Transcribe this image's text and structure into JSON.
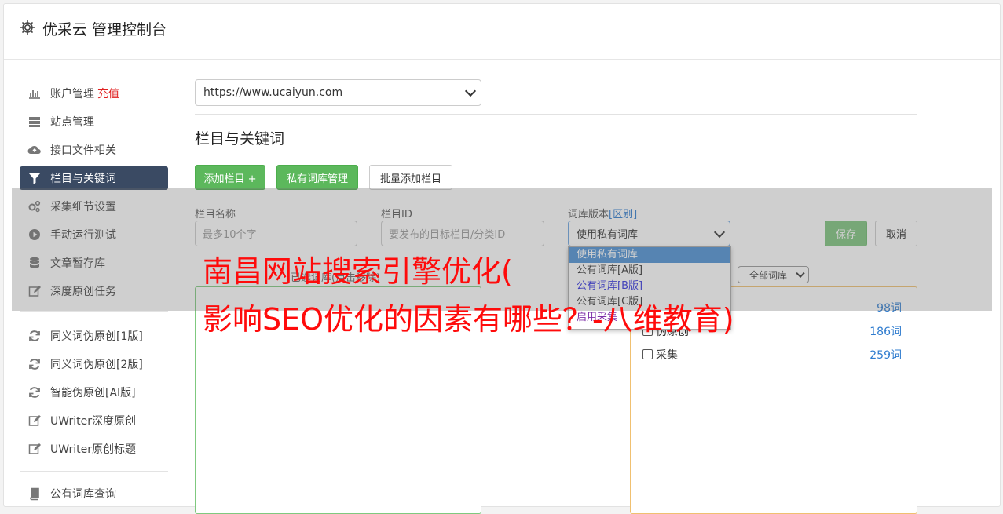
{
  "header": {
    "title": "优采云 管理控制台"
  },
  "sidebar": {
    "items": [
      {
        "label": "账户管理",
        "badge": "充值"
      },
      {
        "label": "站点管理"
      },
      {
        "label": "接口文件相关"
      },
      {
        "label": "栏目与关键词"
      },
      {
        "label": "采集细节设置"
      },
      {
        "label": "手动运行测试"
      },
      {
        "label": "文章暂存库"
      },
      {
        "label": "深度原创任务"
      },
      {
        "label": "同义词伪原创[1版]"
      },
      {
        "label": "同义词伪原创[2版]"
      },
      {
        "label": "智能伪原创[AI版]"
      },
      {
        "label": "UWriter深度原创"
      },
      {
        "label": "UWriter原创标题"
      },
      {
        "label": "公有词库查询"
      }
    ]
  },
  "main": {
    "site_select": "https://www.ucaiyun.com",
    "section_title": "栏目与关键词",
    "buttons": {
      "add_column": "添加栏目 +",
      "private_lib": "私有词库管理",
      "batch_add": "批量添加栏目"
    },
    "form": {
      "name_label": "栏目名称",
      "name_placeholder": "最多10个字",
      "id_label": "栏目ID",
      "id_placeholder": "要发布的目标栏目/分类ID",
      "version_label": "词库版本",
      "version_link": "[区别]",
      "version_value": "使用私有词库",
      "save": "保存",
      "cancel": "取消"
    },
    "version_options": [
      "使用私有词库",
      "公有词库[A版]",
      "公有词库[B版]",
      "公有词库[C版]",
      "启用采集"
    ],
    "filter_select": "全部词库",
    "left_panel_hint": "已选词库(点击移除)",
    "lib_rows": [
      {
        "name": "",
        "count": "98词"
      },
      {
        "name": "伪原创",
        "count": "186词"
      },
      {
        "name": "采集",
        "count": "259词"
      }
    ]
  },
  "overlay": {
    "line1": "南昌网站搜索引擎优化(",
    "line2": "影响SEO优化的因素有哪些？-八维教育)"
  },
  "colors": {
    "sidebar_active": "#3a4a63",
    "primary_green": "#5cb85c",
    "overlay_text": "#ff0b0b",
    "link_blue": "#2f7ccf"
  }
}
